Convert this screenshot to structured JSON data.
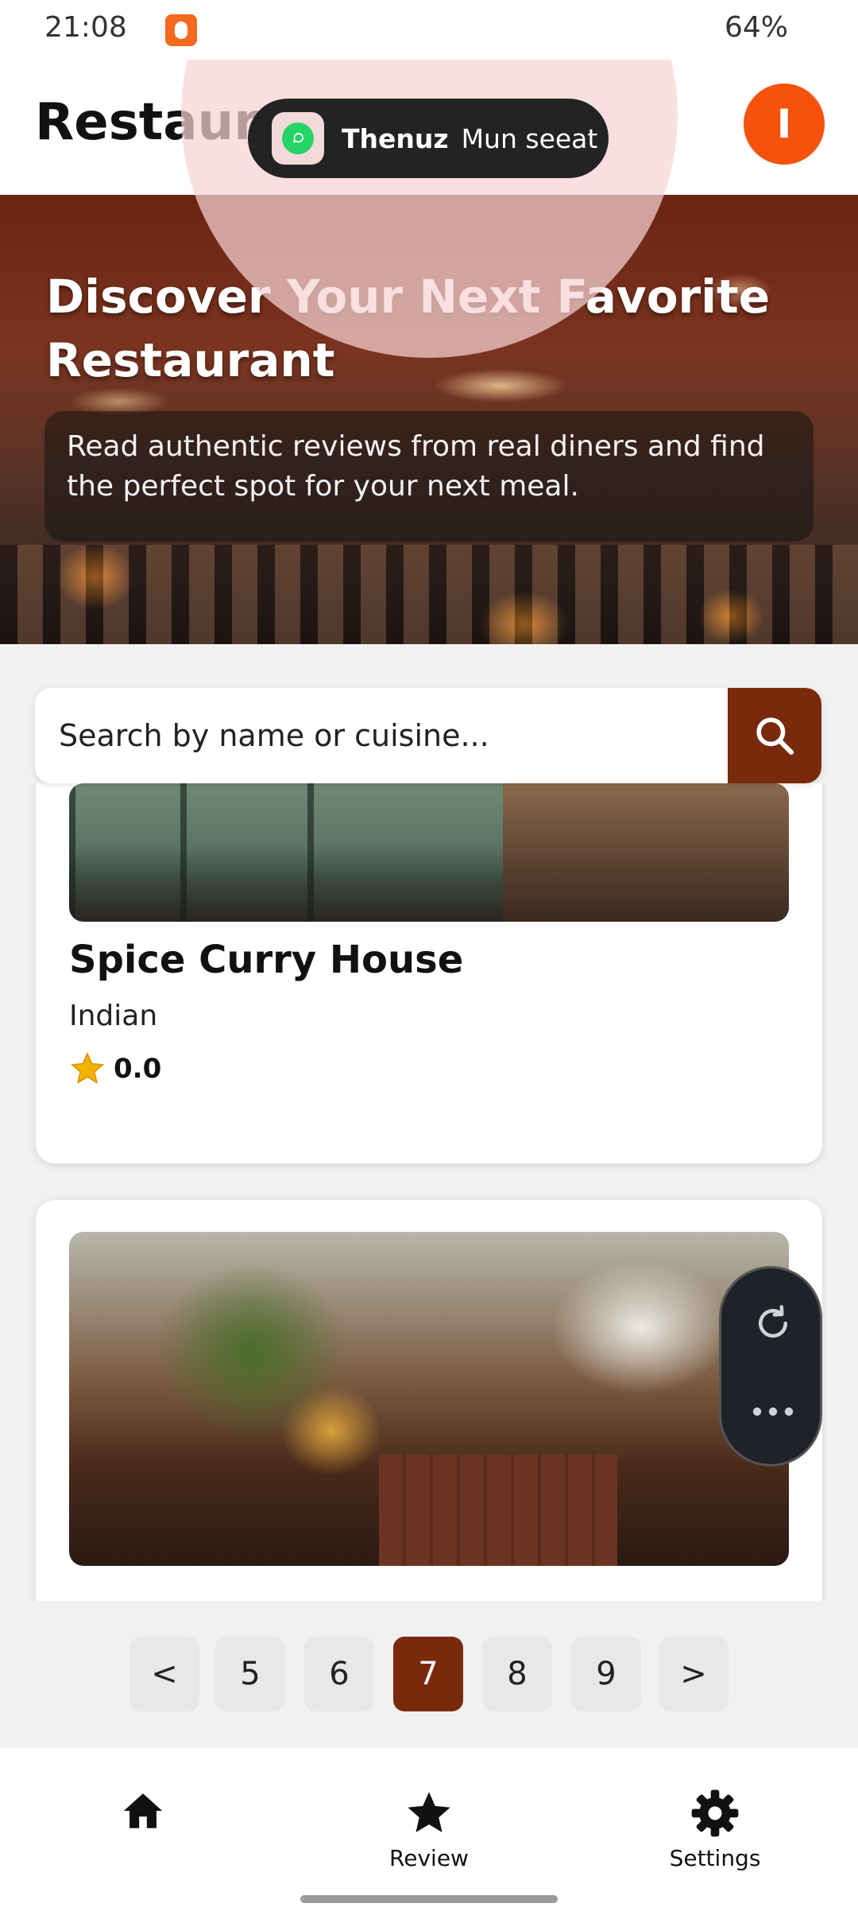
{
  "status_bar": {
    "time": "21:08",
    "battery": "64%"
  },
  "header": {
    "title": "Restaurant",
    "avatar_letter": "I"
  },
  "notification": {
    "sender": "Thenuz",
    "message": "Mun seeat",
    "app_icon": "whatsapp-icon"
  },
  "hero": {
    "title": "Discover Your Next Favorite Restaurant",
    "description": "Read authentic reviews from real diners and find the perfect spot for your next meal."
  },
  "search": {
    "placeholder": "Search by name or cuisine...",
    "button_icon": "search-icon"
  },
  "restaurants": [
    {
      "name": "Spice Curry House",
      "cuisine": "Indian",
      "rating": "0.0"
    }
  ],
  "floating_actions": [
    "refresh-icon",
    "more-icon"
  ],
  "pagination": {
    "prev": "<",
    "pages": [
      "5",
      "6",
      "7",
      "8",
      "9"
    ],
    "current": "7",
    "next": ">"
  },
  "bottom_nav": {
    "items": [
      {
        "icon": "home-icon",
        "label": ""
      },
      {
        "icon": "star-icon",
        "label": "Review"
      },
      {
        "icon": "gear-icon",
        "label": "Settings"
      }
    ]
  },
  "colors": {
    "primary": "#7a2a0c",
    "avatar": "#f4520d",
    "star": "#f5b301"
  }
}
